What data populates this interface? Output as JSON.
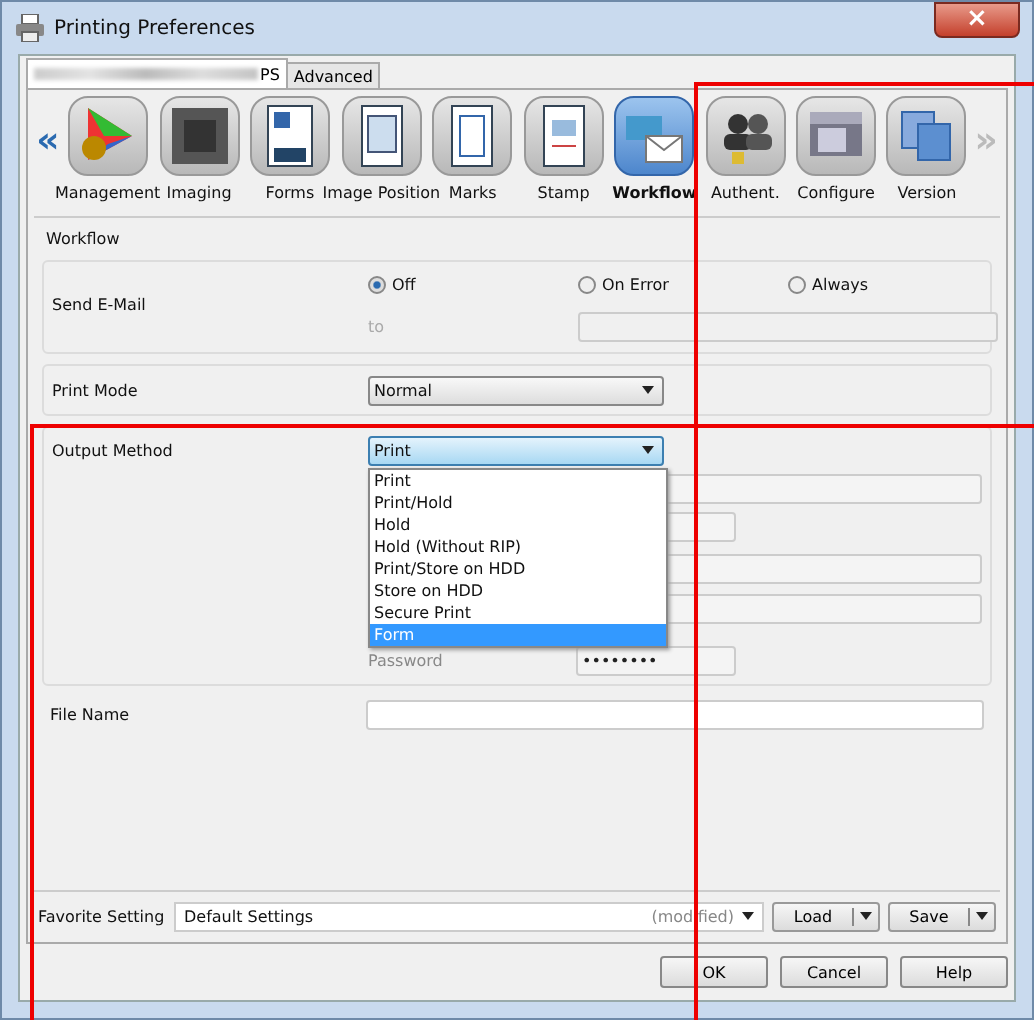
{
  "window": {
    "title": "Printing Preferences",
    "close": "×"
  },
  "tabs": [
    {
      "label": "PS",
      "redacted": true,
      "selected": true
    },
    {
      "label": "Advanced",
      "selected": false
    }
  ],
  "toolbar": {
    "prev": "«",
    "next": "»",
    "items": [
      {
        "label": "Management",
        "kind": "palette",
        "selected": false
      },
      {
        "label": "Imaging",
        "kind": "screen",
        "selected": false
      },
      {
        "label": "Forms",
        "kind": "forms",
        "selected": false
      },
      {
        "label": "Image Position",
        "kind": "page",
        "selected": false
      },
      {
        "label": "Marks",
        "kind": "marks",
        "selected": false
      },
      {
        "label": "Stamp",
        "kind": "stamp",
        "selected": false
      },
      {
        "label": "Workflow",
        "kind": "workflow",
        "selected": true
      },
      {
        "label": "Authent.",
        "kind": "users",
        "selected": false
      },
      {
        "label": "Configure",
        "kind": "device",
        "selected": false
      },
      {
        "label": "Version",
        "kind": "version",
        "selected": false
      }
    ]
  },
  "group": {
    "title": "Workflow",
    "send_email": {
      "label": "Send E-Mail",
      "options": [
        {
          "label": "Off",
          "selected": true
        },
        {
          "label": "On Error",
          "selected": false
        },
        {
          "label": "Always",
          "selected": false
        }
      ],
      "to_label": "to",
      "to_disabled": true
    },
    "print_mode": {
      "label": "Print Mode",
      "value": "Normal"
    },
    "output_method": {
      "label": "Output Method",
      "value": "Print",
      "options": [
        {
          "label": "Print",
          "highlighted": false
        },
        {
          "label": "Print/Hold",
          "highlighted": false
        },
        {
          "label": "Hold",
          "highlighted": false
        },
        {
          "label": "Hold (Without RIP)",
          "highlighted": false
        },
        {
          "label": "Print/Store on HDD",
          "highlighted": false
        },
        {
          "label": "Store on HDD",
          "highlighted": false
        },
        {
          "label": "Secure Print",
          "highlighted": false
        },
        {
          "label": "Form",
          "highlighted": true
        }
      ],
      "password_label": "Password",
      "password_value": "••••••••"
    },
    "file_name": {
      "label": "File Name"
    }
  },
  "favorite": {
    "label": "Favorite Setting",
    "value": "Default Settings",
    "note": "(modified)",
    "buttons": [
      "Load",
      "Save"
    ]
  },
  "buttons": [
    "OK",
    "Cancel",
    "Help"
  ]
}
